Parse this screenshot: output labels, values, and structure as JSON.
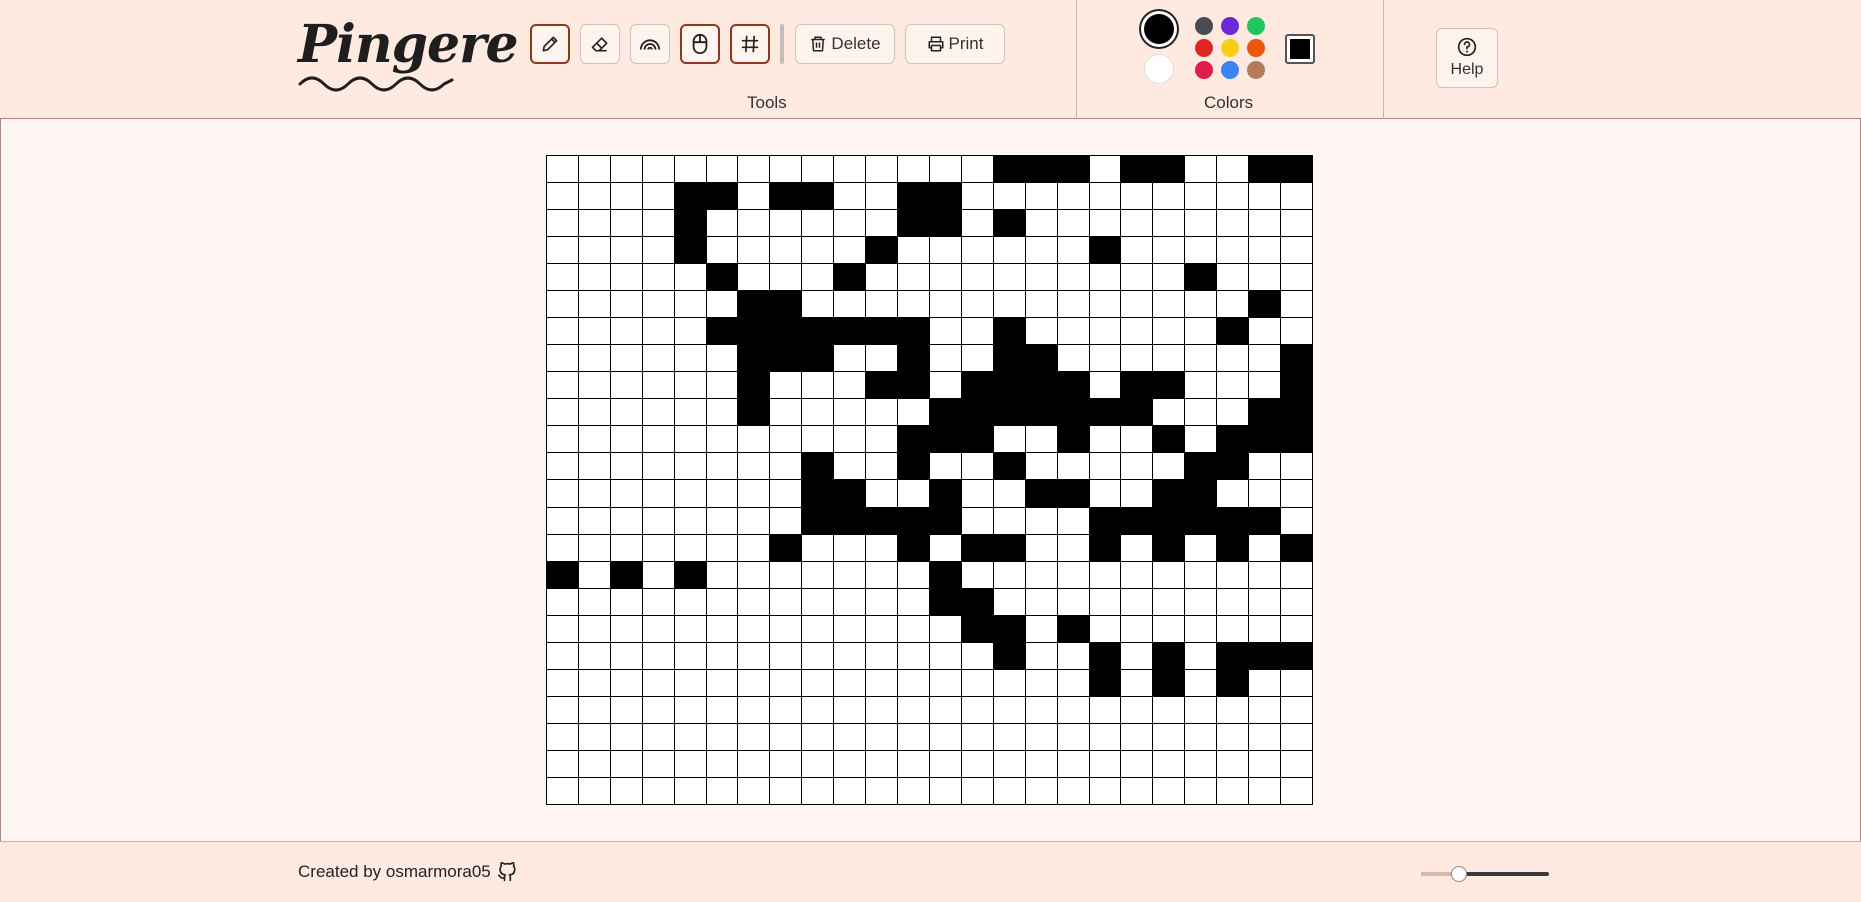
{
  "app": {
    "logo_text": "Pingere"
  },
  "toolbar": {
    "tools": [
      {
        "name": "pencil-tool",
        "icon": "pencil-icon",
        "active": true
      },
      {
        "name": "eraser-tool",
        "icon": "eraser-icon",
        "active": false
      },
      {
        "name": "rainbow-tool",
        "icon": "rainbow-icon",
        "active": false
      },
      {
        "name": "mouse-tool",
        "icon": "mouse-icon",
        "active": true
      },
      {
        "name": "grid-toggle",
        "icon": "hash-icon",
        "active": true
      }
    ],
    "delete_label": "Delete",
    "print_label": "Print",
    "tools_label": "Tools"
  },
  "colors": {
    "label": "Colors",
    "selected": "#000000",
    "primary": [
      "#000000",
      "#ffffff"
    ],
    "palette": [
      "#4b4b52",
      "#6d28d9",
      "#22c55e",
      "#dc2626",
      "#facc15",
      "#ea580c",
      "#e11d48",
      "#3b82f6",
      "#b87a5c"
    ]
  },
  "help": {
    "label": "Help"
  },
  "grid": {
    "rows": 24,
    "cols": 24,
    "fill_color": "#000000",
    "cells": [
      "..............###.##..##",
      "....##.##..##...........",
      "....#......##.#.........",
      "....#.....#......#......",
      ".....#...#..........#...",
      "......##..............#.",
      ".....#######..#......#..",
      "......###..#..##.......#",
      "......#...##.####.##...#",
      "......#.....#######...##",
      "...........###..#..#.###",
      "........#..#..#.....##..",
      "........##..#..##..##...",
      "........#####....######.",
      ".......#...#.##..#.#.#.#",
      "#.#.#.......#...........",
      "............##..........",
      ".............##.#.......",
      "..............#..#.#.###",
      ".................#.#.#..",
      "........................",
      "........................",
      "........................",
      "........................"
    ]
  },
  "footer": {
    "credit": "Created by osmarmora05",
    "github_icon": "github-icon",
    "zoom_level": 0.3
  }
}
